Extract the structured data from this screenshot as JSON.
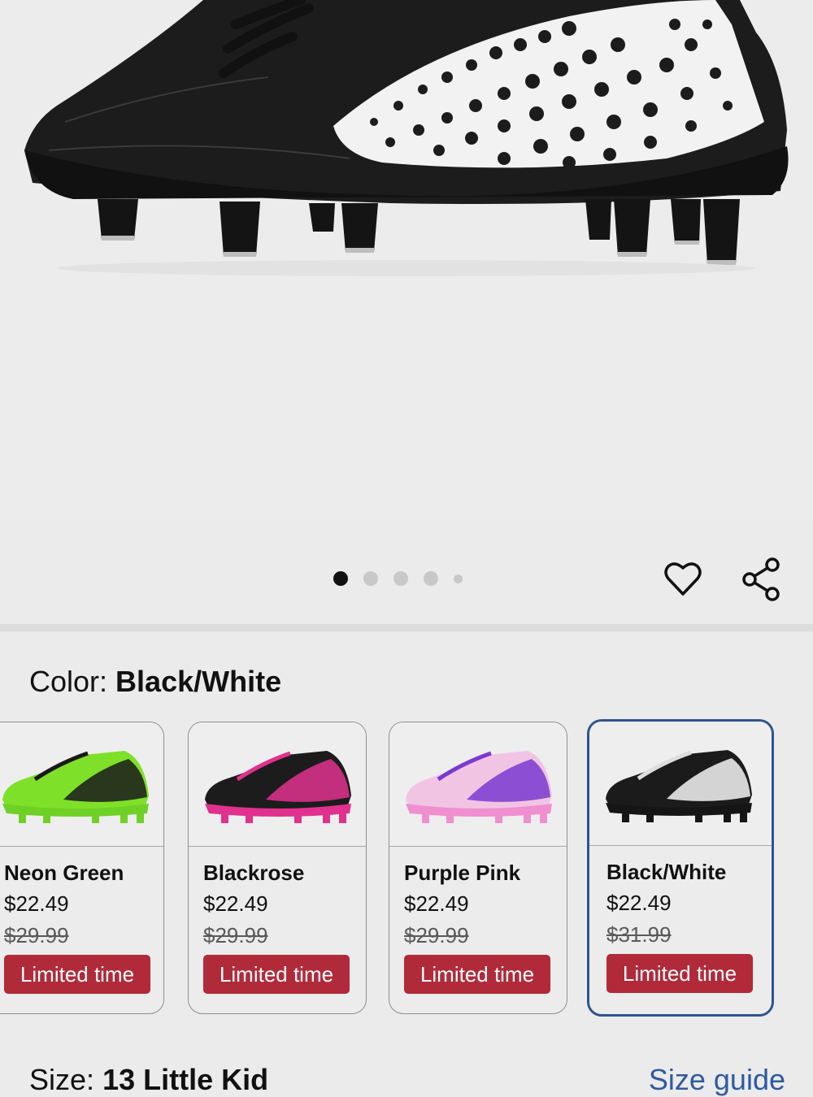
{
  "product_image": {
    "alt_icon": "soccer-cleat-black-white",
    "pager": {
      "count": 5,
      "active_index": 0
    }
  },
  "actions": {
    "wishlist_icon": "heart-icon",
    "share_icon": "share-icon"
  },
  "color_selector": {
    "label": "Color:",
    "selected_value": "Black/White",
    "options": [
      {
        "name": "Neon Green",
        "price": "$22.49",
        "original_price": "$29.99",
        "badge": "Limited time",
        "upper_color": "#7fe02a",
        "accent_color": "#1a1a1a",
        "sole_color": "#6fd125"
      },
      {
        "name": "Blackrose",
        "price": "$22.49",
        "original_price": "$29.99",
        "badge": "Limited time",
        "upper_color": "#1c1c1c",
        "accent_color": "#e0318e",
        "sole_color": "#e0318e"
      },
      {
        "name": "Purple Pink",
        "price": "$22.49",
        "original_price": "$29.99",
        "badge": "Limited time",
        "upper_color": "#f2c4e4",
        "accent_color": "#7a3bd0",
        "sole_color": "#ef8fcf"
      },
      {
        "name": "Black/White",
        "price": "$22.49",
        "original_price": "$31.99",
        "badge": "Limited time",
        "upper_color": "#1b1b1b",
        "accent_color": "#f4f4f4",
        "sole_color": "#151515"
      }
    ]
  },
  "size_selector": {
    "label": "Size:",
    "selected_value": "13 Little Kid",
    "guide_link": "Size guide"
  },
  "colors": {
    "badge_red": "#b12a3a",
    "selected_border": "#2f5490",
    "link_blue": "#2f5aa0"
  }
}
